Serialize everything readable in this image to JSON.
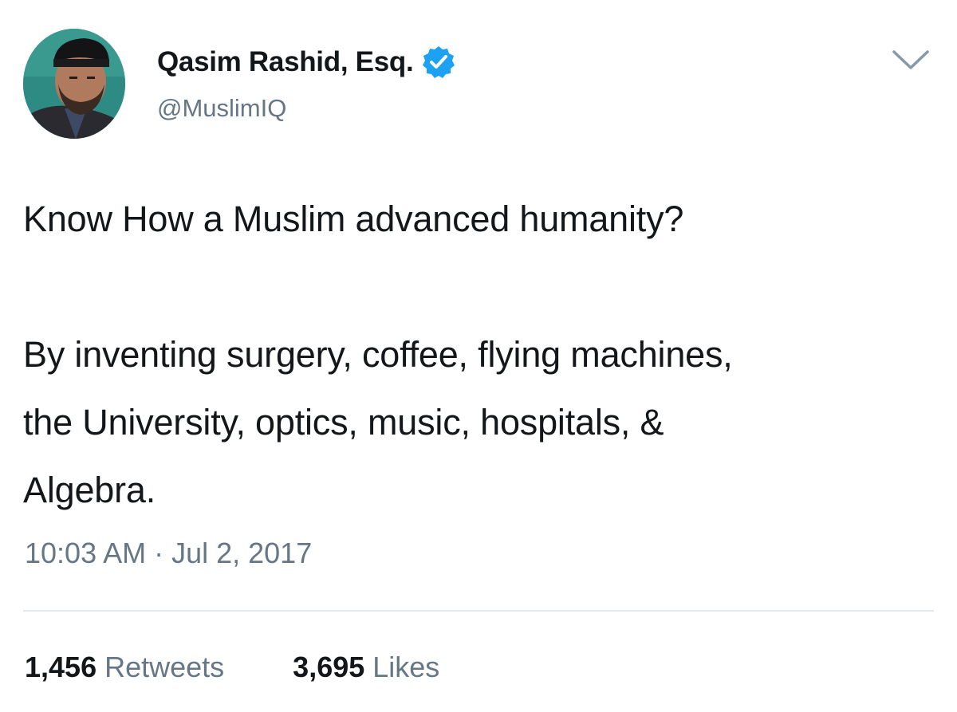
{
  "colors": {
    "text": "#14171a",
    "secondary": "#657786",
    "verified": "#1da1f2",
    "divider": "#e1e8ed"
  },
  "author": {
    "display_name": "Qasim Rashid, Esq.",
    "handle": "@MuslimIQ",
    "verified": true,
    "avatar_icon": "avatar-photo"
  },
  "menu_icon": "chevron-down-icon",
  "tweet": {
    "lines": [
      "Know How a Muslim advanced humanity?",
      "By inventing surgery, coffee, flying machines,",
      "the University, optics, music, hospitals, &",
      "Algebra."
    ]
  },
  "timestamp": "10:03 AM · Jul 2, 2017",
  "stats": {
    "retweets_count": "1,456",
    "retweets_label": "Retweets",
    "likes_count": "3,695",
    "likes_label": "Likes"
  }
}
